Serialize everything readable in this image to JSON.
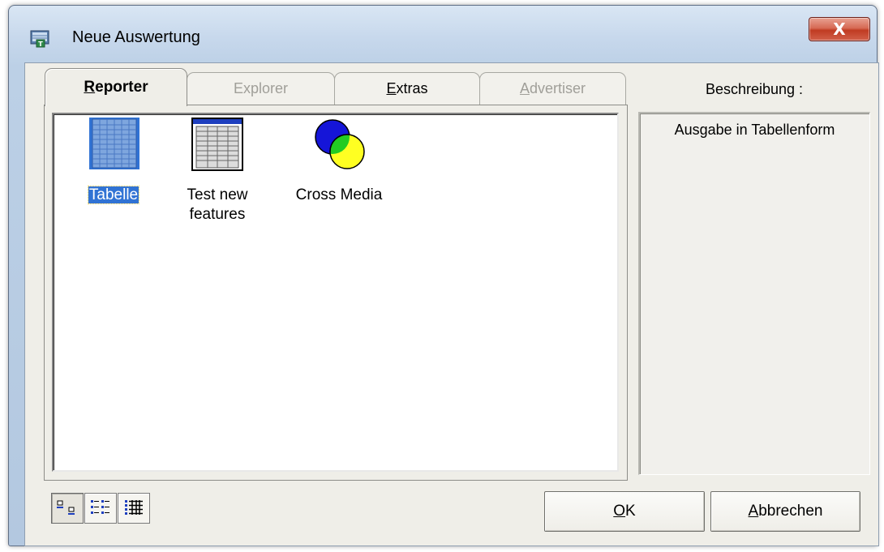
{
  "window": {
    "title": "Neue Auswertung",
    "close_label": "X"
  },
  "tabs": [
    {
      "mnemonic": "R",
      "rest": "eporter",
      "active": true,
      "enabled": true
    },
    {
      "mnemonic": "E",
      "rest": "xplorer",
      "pre": "",
      "active": false,
      "enabled": false
    },
    {
      "mnemonic": "E",
      "rest": "xtras",
      "active": false,
      "enabled": true
    },
    {
      "mnemonic": "A",
      "rest": "dvertiser",
      "active": false,
      "enabled": false
    }
  ],
  "items": [
    {
      "label": "Tabelle",
      "selected": true,
      "icon": "table-grid-icon"
    },
    {
      "label_line1": "Test new",
      "label_line2": "features",
      "selected": false,
      "icon": "spreadsheet-icon"
    },
    {
      "label": "Cross Media",
      "selected": false,
      "icon": "venn-circles-icon"
    }
  ],
  "description": {
    "title": "Beschreibung :",
    "text": "Ausgabe in Tabellenform"
  },
  "view_buttons": [
    {
      "icon": "large-icons-view-icon",
      "pressed": true
    },
    {
      "icon": "list-view-icon",
      "pressed": false
    },
    {
      "icon": "details-view-icon",
      "pressed": false
    }
  ],
  "buttons": {
    "ok_mnemonic": "O",
    "ok_rest": "K",
    "cancel_mnemonic": "A",
    "cancel_rest": "bbrechen"
  },
  "colors": {
    "selection": "#3173d4",
    "close_button": "#c03b22",
    "dialog_face": "#efeee8"
  }
}
